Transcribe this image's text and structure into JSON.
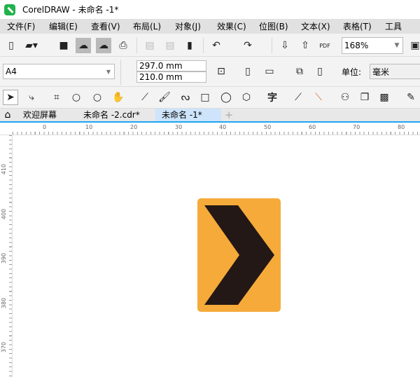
{
  "window": {
    "title": "CorelDRAW - 未命名 -1*"
  },
  "menu": [
    "文件(F)",
    "编辑(E)",
    "查看(V)",
    "布局(L)",
    "对象(J)",
    "效果(C)",
    "位图(B)",
    "文本(X)",
    "表格(T)",
    "工具"
  ],
  "toolbar": {
    "zoom": "168%",
    "pdf_label": "PDF"
  },
  "property_bar": {
    "page_size": "A4",
    "height": "297.0 mm",
    "width": "210.0 mm",
    "units_label": "单位:",
    "units": "毫米"
  },
  "tabs": [
    {
      "label": "欢迎屏幕"
    },
    {
      "label": "未命名 -2.cdr*"
    },
    {
      "label": "未命名 -1*",
      "active": true
    }
  ],
  "ruler_h": [
    "0",
    "10",
    "20",
    "30",
    "40",
    "50",
    "60",
    "70",
    "80"
  ],
  "ruler_v": [
    "410",
    "400",
    "390",
    "380",
    "370"
  ],
  "colors": {
    "sign": "#F5AA3A",
    "chevron": "#231815",
    "accent": "#1EA5F2"
  }
}
